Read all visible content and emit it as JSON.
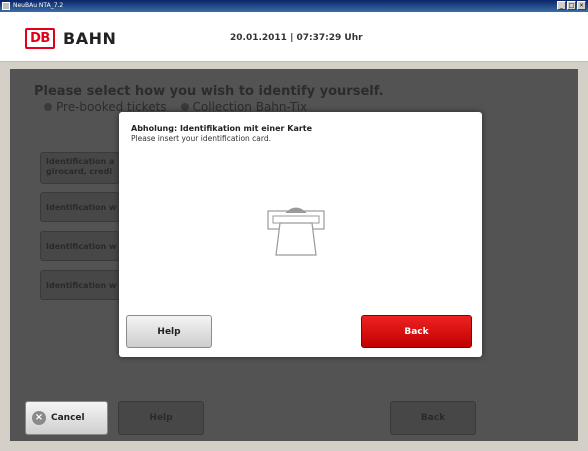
{
  "window": {
    "title": "NeuBAu NTA_7.2",
    "minimize": "_",
    "maximize": "□",
    "close": "×"
  },
  "header": {
    "logo": "DB",
    "brand": "BAHN",
    "datetime": "20.01.2011 | 07:37:29 Uhr",
    "logo_color": "#e2001a"
  },
  "background": {
    "heading": "Please select how you wish to identify yourself.",
    "radio_options": [
      "Pre-booked tickets",
      "Collection Bahn-Tix"
    ],
    "options": [
      {
        "label": "Identification a",
        "label2": "girocard, credi"
      },
      {
        "label": "Identification w"
      },
      {
        "label": "Identification w"
      },
      {
        "label": "Identification w"
      }
    ],
    "cancel": "Cancel",
    "help": "Help",
    "back": "Back"
  },
  "modal": {
    "title": "Abholung: Identifikation mit einer Karte",
    "text": "Please insert your identification card.",
    "card_icon": "card-insert-icon",
    "help": "Help",
    "back": "Back",
    "back_color": "#e00000"
  }
}
